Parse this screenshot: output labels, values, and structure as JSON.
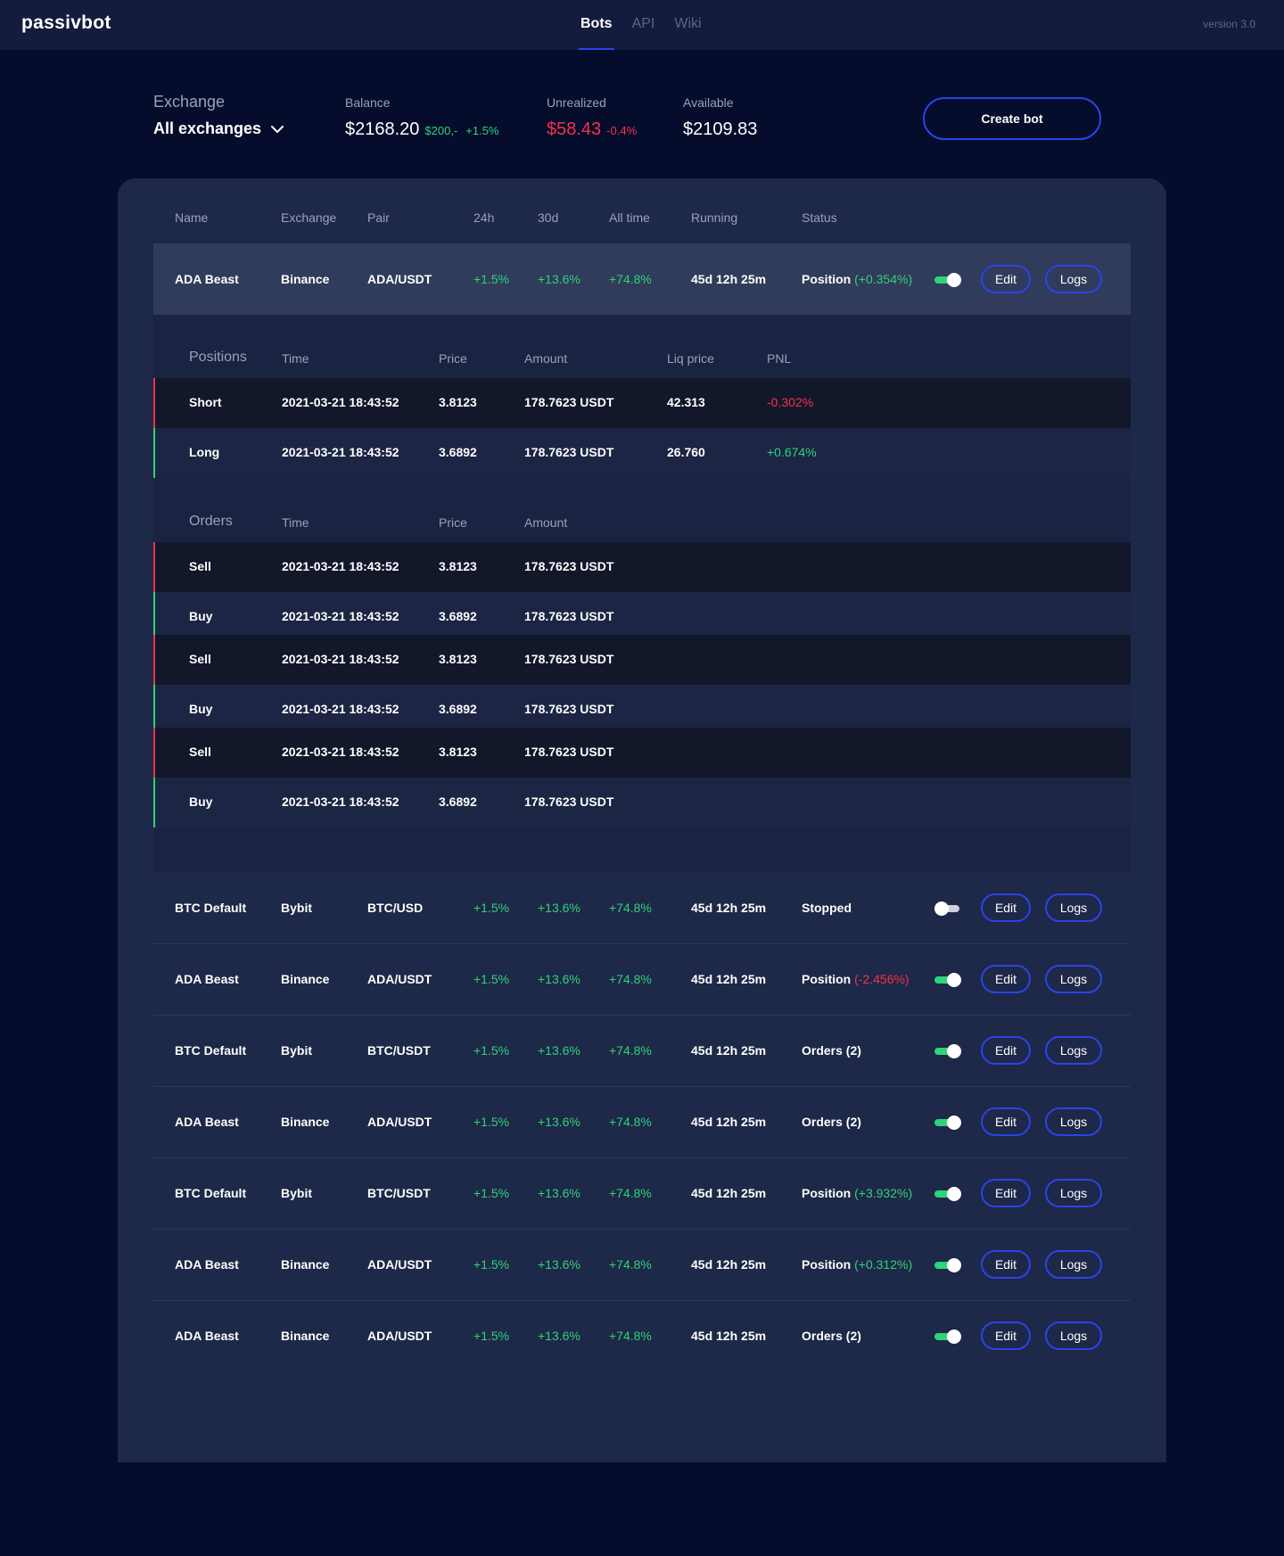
{
  "nav": {
    "logo": "passivbot",
    "items": [
      {
        "label": "Bots",
        "active": true
      },
      {
        "label": "API",
        "active": false
      },
      {
        "label": "Wiki",
        "active": false
      }
    ],
    "version": "version 3.0"
  },
  "summary": {
    "exchange_label": "Exchange",
    "exchange_value": "All exchanges",
    "balance_label": "Balance",
    "balance_value": "$2168.20",
    "balance_change_abs": "$200,-",
    "balance_change_pct": "+1.5%",
    "unrealized_label": "Unrealized",
    "unrealized_value": "$58.43",
    "unrealized_change": "-0.4%",
    "available_label": "Available",
    "available_value": "$2109.83",
    "create_button": "Create bot"
  },
  "table": {
    "headers": {
      "name": "Name",
      "exchange": "Exchange",
      "pair": "Pair",
      "h24": "24h",
      "d30": "30d",
      "all_time": "All time",
      "running": "Running",
      "status": "Status"
    },
    "edit_label": "Edit",
    "logs_label": "Logs",
    "rows": [
      {
        "name": "ADA Beast",
        "exchange": "Binance",
        "pair": "ADA/USDT",
        "h24": "+1.5%",
        "d30": "+13.6%",
        "all_time": "+74.8%",
        "running": "45d 12h 25m",
        "status": "Position",
        "status_detail": "(+0.354%)",
        "status_color": "green",
        "enabled": true
      },
      {
        "name": "BTC Default",
        "exchange": "Bybit",
        "pair": "BTC/USD",
        "h24": "+1.5%",
        "d30": "+13.6%",
        "all_time": "+74.8%",
        "running": "45d 12h 25m",
        "status": "Stopped",
        "status_detail": "",
        "status_color": "",
        "enabled": false
      },
      {
        "name": "ADA Beast",
        "exchange": "Binance",
        "pair": "ADA/USDT",
        "h24": "+1.5%",
        "d30": "+13.6%",
        "all_time": "+74.8%",
        "running": "45d 12h 25m",
        "status": "Position",
        "status_detail": "(-2.456%)",
        "status_color": "red",
        "enabled": true
      },
      {
        "name": "BTC Default",
        "exchange": "Bybit",
        "pair": "BTC/USDT",
        "h24": "+1.5%",
        "d30": "+13.6%",
        "all_time": "+74.8%",
        "running": "45d 12h 25m",
        "status": "Orders (2)",
        "status_detail": "",
        "status_color": "",
        "enabled": true
      },
      {
        "name": "ADA Beast",
        "exchange": "Binance",
        "pair": "ADA/USDT",
        "h24": "+1.5%",
        "d30": "+13.6%",
        "all_time": "+74.8%",
        "running": "45d 12h 25m",
        "status": "Orders (2)",
        "status_detail": "",
        "status_color": "",
        "enabled": true
      },
      {
        "name": "BTC Default",
        "exchange": "Bybit",
        "pair": "BTC/USDT",
        "h24": "+1.5%",
        "d30": "+13.6%",
        "all_time": "+74.8%",
        "running": "45d 12h 25m",
        "status": "Position",
        "status_detail": "(+3.932%)",
        "status_color": "green",
        "enabled": true
      },
      {
        "name": "ADA Beast",
        "exchange": "Binance",
        "pair": "ADA/USDT",
        "h24": "+1.5%",
        "d30": "+13.6%",
        "all_time": "+74.8%",
        "running": "45d 12h 25m",
        "status": "Position",
        "status_detail": "(+0.312%)",
        "status_color": "green",
        "enabled": true
      },
      {
        "name": "ADA Beast",
        "exchange": "Binance",
        "pair": "ADA/USDT",
        "h24": "+1.5%",
        "d30": "+13.6%",
        "all_time": "+74.8%",
        "running": "45d 12h 25m",
        "status": "Orders (2)",
        "status_detail": "",
        "status_color": "",
        "enabled": true
      }
    ]
  },
  "positions": {
    "title": "Positions",
    "headers": {
      "time": "Time",
      "price": "Price",
      "amount": "Amount",
      "liq": "Liq price",
      "pnl": "PNL"
    },
    "rows": [
      {
        "side": "Short",
        "time": "2021-03-21 18:43:52",
        "price": "3.8123",
        "amount": "178.7623 USDT",
        "liq": "42.313",
        "pnl": "-0.302%",
        "color": "red"
      },
      {
        "side": "Long",
        "time": "2021-03-21 18:43:52",
        "price": "3.6892",
        "amount": "178.7623 USDT",
        "liq": "26.760",
        "pnl": "+0.674%",
        "color": "green"
      }
    ]
  },
  "orders": {
    "title": "Orders",
    "headers": {
      "time": "Time",
      "price": "Price",
      "amount": "Amount"
    },
    "rows": [
      {
        "side": "Sell",
        "time": "2021-03-21 18:43:52",
        "price": "3.8123",
        "amount": "178.7623 USDT",
        "color": "red"
      },
      {
        "side": "Buy",
        "time": "2021-03-21 18:43:52",
        "price": "3.6892",
        "amount": "178.7623 USDT",
        "color": "green"
      },
      {
        "side": "Sell",
        "time": "2021-03-21 18:43:52",
        "price": "3.8123",
        "amount": "178.7623 USDT",
        "color": "red"
      },
      {
        "side": "Buy",
        "time": "2021-03-21 18:43:52",
        "price": "3.6892",
        "amount": "178.7623 USDT",
        "color": "green"
      },
      {
        "side": "Sell",
        "time": "2021-03-21 18:43:52",
        "price": "3.8123",
        "amount": "178.7623 USDT",
        "color": "red"
      },
      {
        "side": "Buy",
        "time": "2021-03-21 18:43:52",
        "price": "3.6892",
        "amount": "178.7623 USDT",
        "color": "green"
      }
    ]
  },
  "colors": {
    "accent": "#2a44e8",
    "positive": "#2ed37a",
    "negative": "#f5334a",
    "background": "#050c2c",
    "panel": "#1e2848"
  }
}
